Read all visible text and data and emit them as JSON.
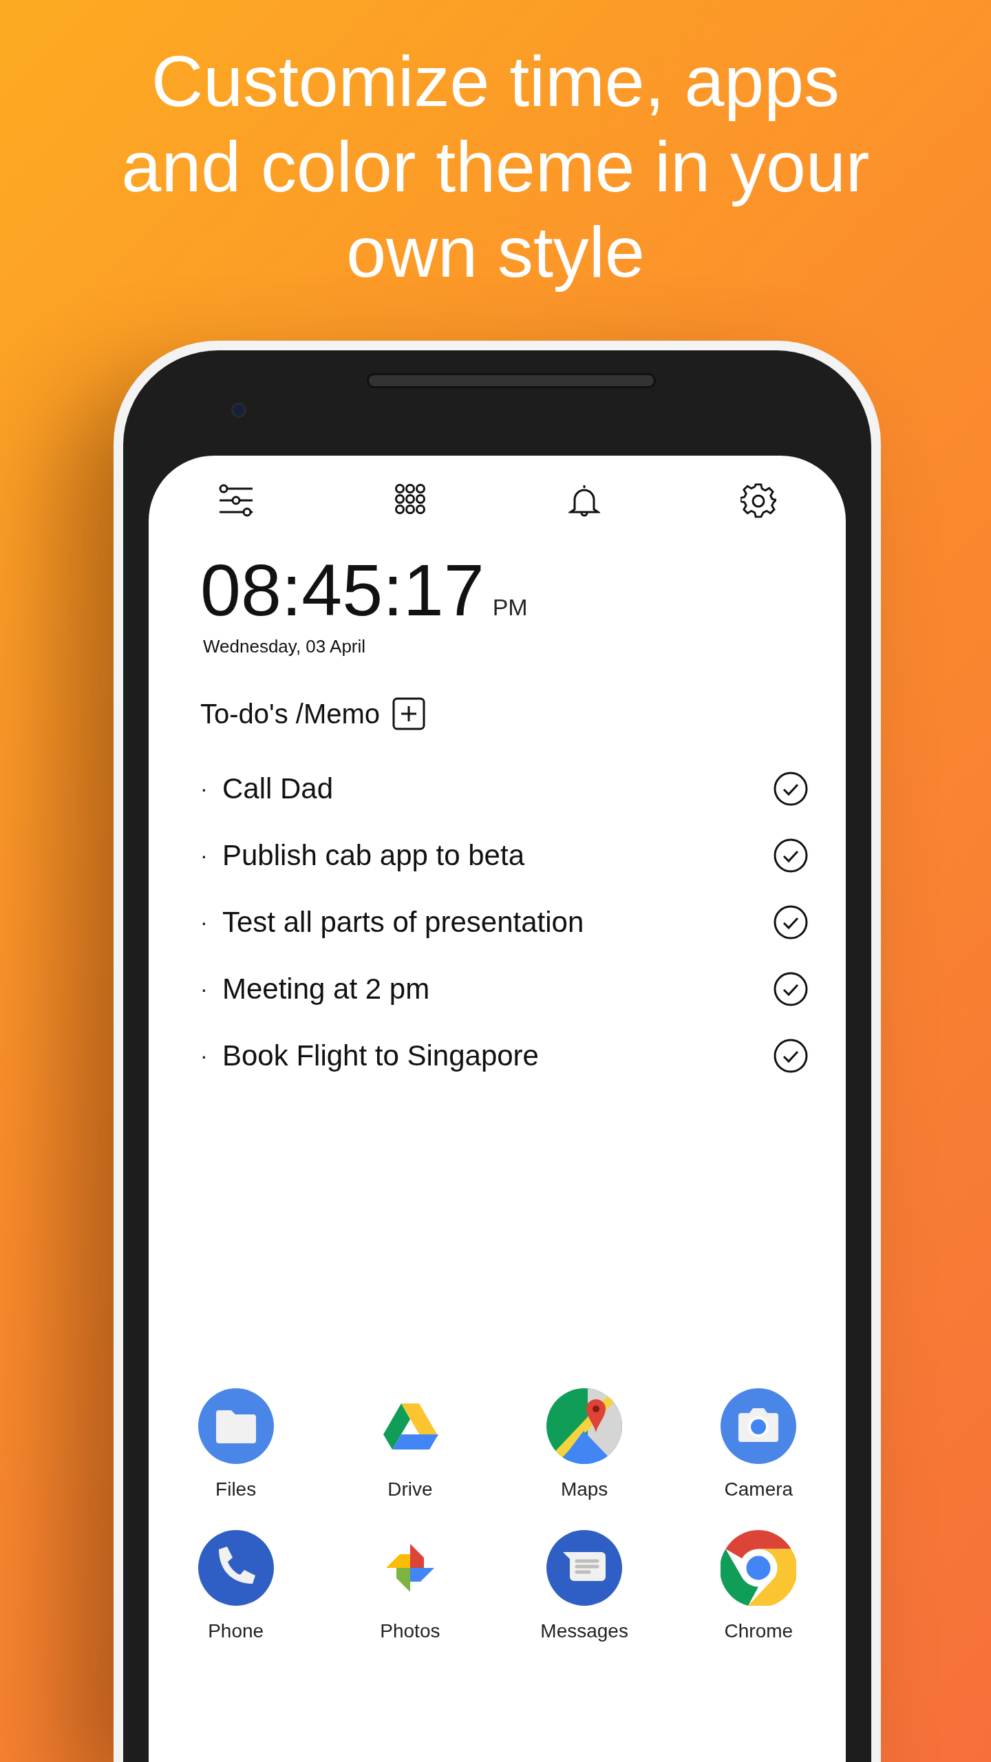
{
  "headline": "Customize time, apps and color theme in your own style",
  "clock": {
    "time": "08:45:17",
    "meridiem": "PM",
    "date": "Wednesday, 03 April"
  },
  "todo": {
    "title": "To-do's /Memo",
    "items": [
      {
        "bullet": "·",
        "text": "Call Dad"
      },
      {
        "bullet": "·",
        "text": "Publish cab app to beta"
      },
      {
        "bullet": "·",
        "text": "Test all parts of presentation"
      },
      {
        "bullet": "·",
        "text": "Meeting at 2 pm"
      },
      {
        "bullet": "·",
        "text": "Book Flight to Singapore"
      }
    ]
  },
  "apps": [
    {
      "label": "Files"
    },
    {
      "label": "Drive"
    },
    {
      "label": "Maps"
    },
    {
      "label": "Camera"
    },
    {
      "label": "Phone"
    },
    {
      "label": "Photos"
    },
    {
      "label": "Messages"
    },
    {
      "label": "Chrome"
    }
  ]
}
